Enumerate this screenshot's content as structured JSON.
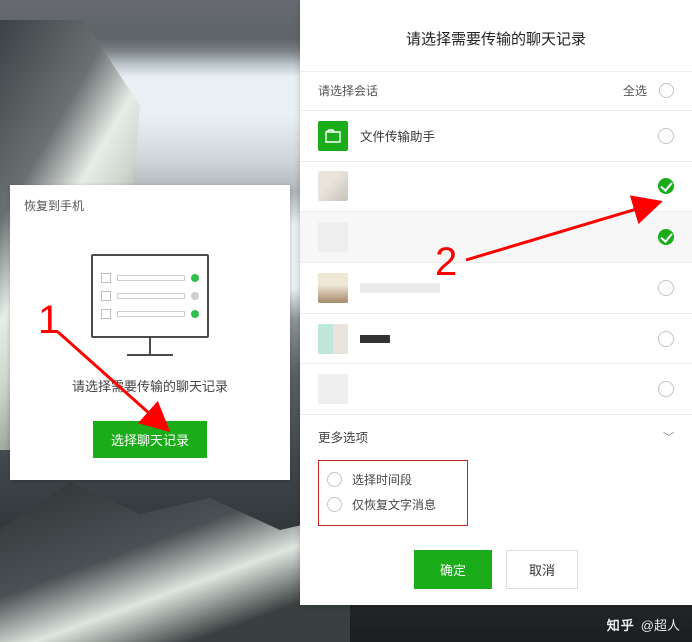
{
  "left_panel": {
    "title": "恢复到手机",
    "subtitle": "请选择需要传输的聊天记录",
    "select_button": "选择聊天记录"
  },
  "right_panel": {
    "title": "请选择需要传输的聊天记录",
    "header": {
      "label": "请选择会话",
      "select_all": "全选"
    },
    "conversations": [
      {
        "name": "文件传输助手",
        "selected": false
      },
      {
        "name": "",
        "selected": true
      },
      {
        "name": "",
        "selected": true
      },
      {
        "name": "",
        "selected": false
      },
      {
        "name": "",
        "selected": false
      },
      {
        "name": "",
        "selected": false
      }
    ],
    "more_options": {
      "label": "更多选项",
      "options": [
        "选择时间段",
        "仅恢复文字消息"
      ]
    },
    "buttons": {
      "ok": "确定",
      "cancel": "取消"
    }
  },
  "annotations": {
    "one": "1",
    "two": "2"
  },
  "watermark": {
    "logo": "知乎",
    "user": "@超人"
  }
}
